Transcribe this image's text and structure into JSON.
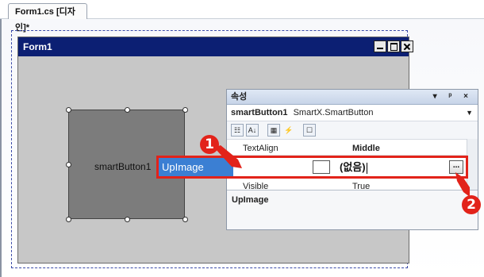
{
  "document_tab": {
    "label": "Form1.cs [디자인]*"
  },
  "form": {
    "title": "Form1",
    "button_label": "smartButton1"
  },
  "properties": {
    "panel_title": "속성",
    "title_controls": "▾ ᵖ ×",
    "object_name": "smartButton1",
    "object_type": "SmartX.SmartButton",
    "toolbar": {
      "categorized": "☷",
      "alphabetical": "A↓",
      "properties": "▦",
      "events": "⚡",
      "property_pages": "☐"
    },
    "rows": [
      {
        "name": "TextAlign",
        "value": "Middle"
      },
      {
        "name": "Visible",
        "value": "True"
      }
    ],
    "highlighted_row": {
      "name": "UpImage",
      "value": "(없음)",
      "button": "..."
    },
    "description_title": "UpImage"
  },
  "annotations": {
    "callout_1": "1",
    "callout_2": "2",
    "color": "#e2231a"
  }
}
